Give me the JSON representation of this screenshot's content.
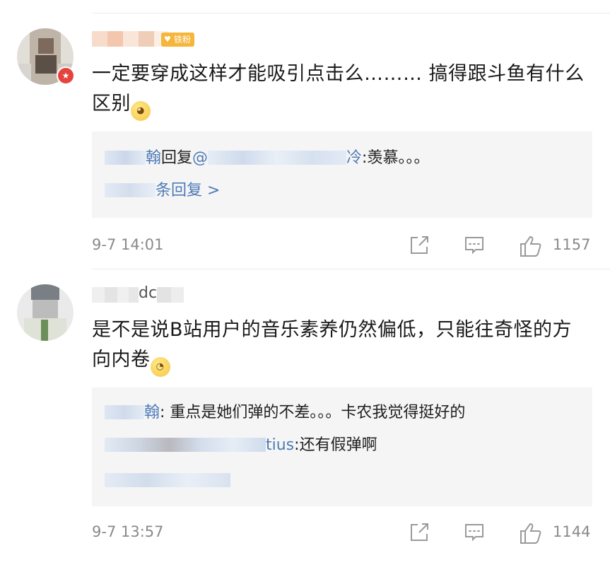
{
  "comments": [
    {
      "fan_badge": "铁粉",
      "text": "一定要穿成这样才能吸引点击么……… 搞得跟斗鱼有什么区别",
      "emoji": "woozy-face-emoji",
      "reply_line_1_name_tail": "翰",
      "reply_line_1_mid": "回复",
      "reply_line_1_at": "@",
      "reply_line_1_name_end": "冷",
      "reply_line_1_text": ":羡慕。。。",
      "reply_more": "条回复",
      "reply_more_arrow": ">",
      "time": "9-7 14:01",
      "likes": "1157"
    },
    {
      "username_tail": "dc",
      "text": "是不是说B站用户的音乐素养仍然偏低，只能往奇怪的方向内卷",
      "emoji": "flushed-face-emoji",
      "reply_line_1_name_tail": "翰",
      "reply_line_1_text": ": 重点是她们弹的不差。。。卡农我觉得挺好的",
      "reply_line_2_name_end": "tius",
      "reply_line_2_text": ":还有假弹啊",
      "time": "9-7 13:57",
      "likes": "1144"
    }
  ],
  "colors": {
    "link_blue": "#4e7bb8",
    "meta_gray": "#8a8a8a",
    "reply_bg": "#f5f5f5",
    "fan_badge": "#f6b53b",
    "avatar_badge": "#e5443e"
  },
  "icons": [
    "share-icon",
    "comment-icon",
    "like-icon",
    "chevron-right-icon"
  ]
}
